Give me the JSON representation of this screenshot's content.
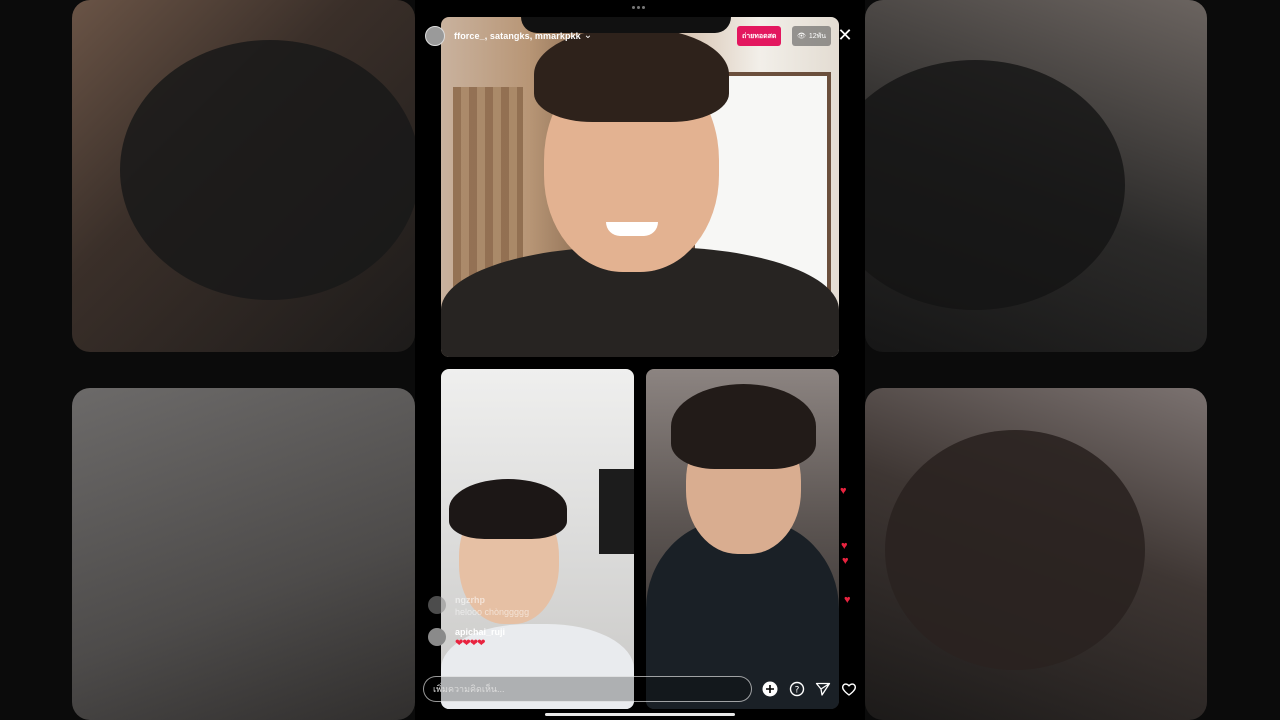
{
  "header": {
    "usernames": "fforce_, satangks, mmarkpkk",
    "live_label": "ถ่ายทอดสด",
    "viewer_count": "12พัน"
  },
  "comments": [
    {
      "username": "ngzrhp",
      "text": "helooo chònggggg"
    },
    {
      "username": "apichai_ruji",
      "text": "❤❤❤❤"
    }
  ],
  "input": {
    "placeholder": "เพิ่มความคิดเห็น..."
  },
  "icons": {
    "close": "close-icon",
    "add": "add-circle-icon",
    "question": "question-icon",
    "share": "send-icon",
    "like": "heart-icon"
  },
  "colors": {
    "live_badge": "#e3175f",
    "heart": "#e8233f"
  }
}
